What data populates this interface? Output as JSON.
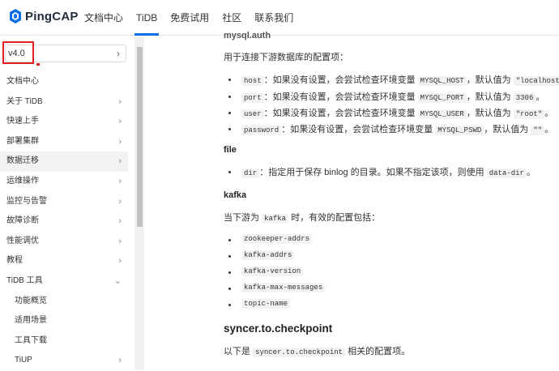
{
  "brand": {
    "name": "PingCAP"
  },
  "nav": [
    {
      "label": "文档中心"
    },
    {
      "label": "TiDB"
    },
    {
      "label": "免费试用"
    },
    {
      "label": "社区"
    },
    {
      "label": "联系我们"
    }
  ],
  "version": {
    "value": "v4.0"
  },
  "sidebar": {
    "items": [
      {
        "label": "文档中心"
      },
      {
        "label": "关于 TiDB"
      },
      {
        "label": "快速上手"
      },
      {
        "label": "部署集群"
      },
      {
        "label": "数据迁移"
      },
      {
        "label": "运维操作"
      },
      {
        "label": "监控与告警"
      },
      {
        "label": "故障诊断"
      },
      {
        "label": "性能调优"
      },
      {
        "label": "教程"
      },
      {
        "label": "TiDB 工具"
      },
      {
        "label": "功能概览"
      },
      {
        "label": "适用场景"
      },
      {
        "label": "工具下载"
      },
      {
        "label": "TiUP"
      }
    ]
  },
  "content": {
    "top_cut": "mysql.auth",
    "intro": "用于连接下游数据库的配置项：",
    "mysql": [
      {
        "code": "host",
        "pre": "：如果没有设置，会尝试检查环境变量 ",
        "env": "MYSQL_HOST",
        "mid": "，默认值为 ",
        "val": "\"localhost\"",
        "end": "。"
      },
      {
        "code": "port",
        "pre": "：如果没有设置，会尝试检查环境变量 ",
        "env": "MYSQL_PORT",
        "mid": "，默认值为 ",
        "val": "3306",
        "end": "。"
      },
      {
        "code": "user",
        "pre": "：如果没有设置，会尝试检查环境变量 ",
        "env": "MYSQL_USER",
        "mid": "，默认值为 ",
        "val": "\"root\"",
        "end": "。"
      },
      {
        "code": "password",
        "pre": "：如果没有设置，会尝试检查环境变量 ",
        "env": "MYSQL_PSWD",
        "mid": "，默认值为 ",
        "val": "\"\"",
        "end": "。"
      }
    ],
    "file_heading": "file",
    "file_item": {
      "code": "dir",
      "pre": "：指定用于保存 binlog 的目录。如果不指定该项，则使用 ",
      "val": "data-dir",
      "end": "。"
    },
    "kafka_heading": "kafka",
    "kafka_intro": {
      "pre": "当下游为 ",
      "code": "kafka",
      "end": " 时，有效的配置包括："
    },
    "kafka_items": [
      "zookeeper-addrs",
      "kafka-addrs",
      "kafka-version",
      "kafka-max-messages",
      "topic-name"
    ],
    "checkpoint_heading": "syncer.to.checkpoint",
    "checkpoint_intro": {
      "pre": "以下是 ",
      "code": "syncer.to.checkpoint",
      "end": " 相关的配置项。"
    }
  }
}
